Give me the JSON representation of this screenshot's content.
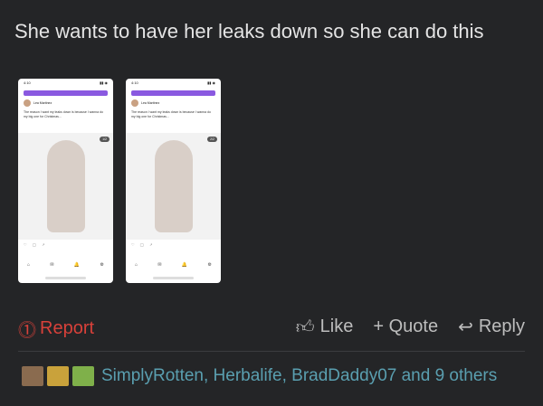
{
  "post": {
    "text": "She wants to have her leaks down so she can do this"
  },
  "thumbnails": [
    {
      "status_time": "4:10",
      "author": "Lea Martinez",
      "caption": "The reason I want my leaks down is because I wanna do my big one for Christmas...",
      "counter": "1/2",
      "tabbar": [
        "⌂",
        "✉",
        "🔔",
        "⚙"
      ]
    },
    {
      "status_time": "4:10",
      "author": "Lea Martinez",
      "caption": "The reason I want my leaks down is because I wanna do my big one for Christmas...",
      "counter": "2/2",
      "tabbar": [
        "⌂",
        "✉",
        "🔔",
        "⚙"
      ]
    }
  ],
  "actions": {
    "report": "Report",
    "like": "Like",
    "quote": "+ Quote",
    "reply": "Reply"
  },
  "reactions": {
    "text": "SimplyRotten, Herbalife, BradDaddy07 and 9 others"
  },
  "colors": {
    "background": "#242527",
    "report": "#d8413a",
    "link": "#5a9fb0"
  }
}
